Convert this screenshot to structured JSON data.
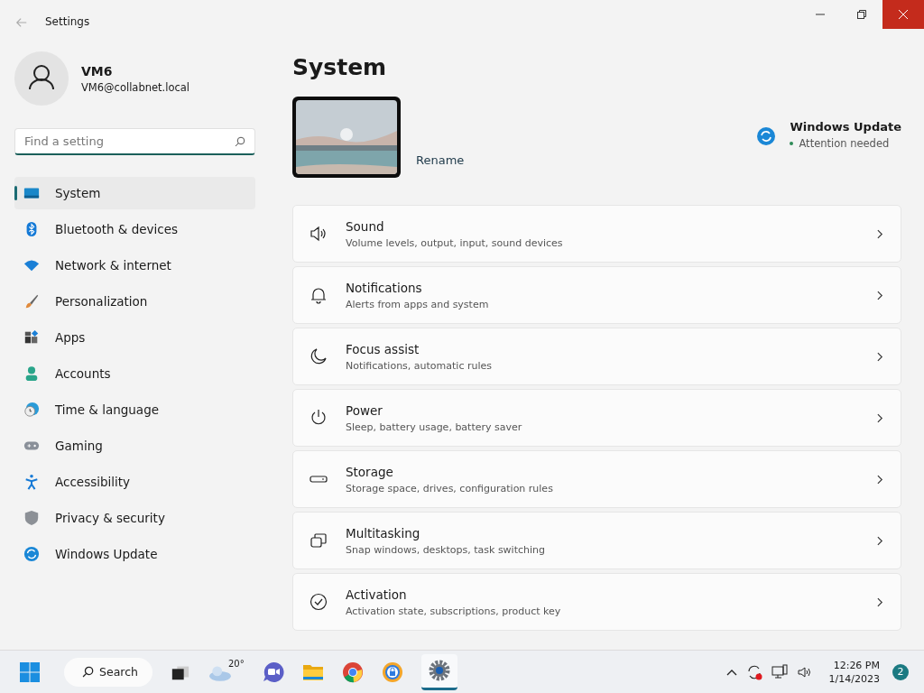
{
  "window": {
    "title": "Settings"
  },
  "account": {
    "name": "VM6",
    "email": "VM6@collabnet.local"
  },
  "search": {
    "placeholder": "Find a setting"
  },
  "sidebar": {
    "items": [
      {
        "label": "System",
        "selected": true
      },
      {
        "label": "Bluetooth & devices",
        "selected": false
      },
      {
        "label": "Network & internet",
        "selected": false
      },
      {
        "label": "Personalization",
        "selected": false
      },
      {
        "label": "Apps",
        "selected": false
      },
      {
        "label": "Accounts",
        "selected": false
      },
      {
        "label": "Time & language",
        "selected": false
      },
      {
        "label": "Gaming",
        "selected": false
      },
      {
        "label": "Accessibility",
        "selected": false
      },
      {
        "label": "Privacy & security",
        "selected": false
      },
      {
        "label": "Windows Update",
        "selected": false
      }
    ]
  },
  "page": {
    "title": "System",
    "rename": "Rename",
    "update": {
      "title": "Windows Update",
      "status": "Attention needed",
      "color": "#2e8b57"
    }
  },
  "cards": [
    {
      "title": "Sound",
      "subtitle": "Volume levels, output, input, sound devices"
    },
    {
      "title": "Notifications",
      "subtitle": "Alerts from apps and system"
    },
    {
      "title": "Focus assist",
      "subtitle": "Notifications, automatic rules"
    },
    {
      "title": "Power",
      "subtitle": "Sleep, battery usage, battery saver"
    },
    {
      "title": "Storage",
      "subtitle": "Storage space, drives, configuration rules"
    },
    {
      "title": "Multitasking",
      "subtitle": "Snap windows, desktops, task switching"
    },
    {
      "title": "Activation",
      "subtitle": "Activation state, subscriptions, product key"
    }
  ],
  "taskbar": {
    "search": "Search",
    "temperature": "20°",
    "time": "12:26 PM",
    "date": "1/14/2023",
    "notifications": "2"
  }
}
